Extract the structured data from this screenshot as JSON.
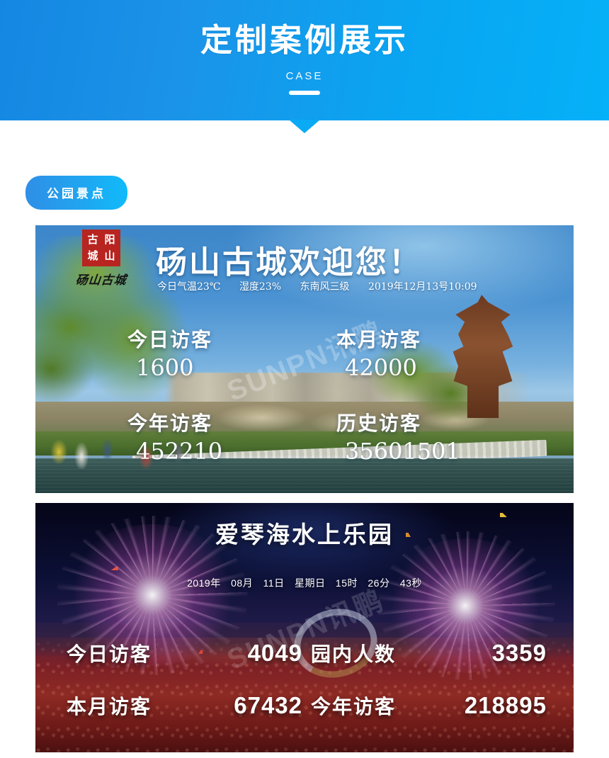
{
  "header": {
    "title": "定制案例展示",
    "subtitle": "CASE",
    "bg_gradient_from": "#1487e2",
    "bg_gradient_to": "#05b1f8"
  },
  "category_tag": {
    "label": "公园景点",
    "color_from": "#2f8fe6",
    "color_to": "#10bbfb"
  },
  "cards": [
    {
      "id": "dangshan-ancient-city",
      "logo_seal": [
        "古",
        "阳",
        "城",
        "山"
      ],
      "logo_wordmark": "砀山古城",
      "title": "砀山古城欢迎您！",
      "weather": [
        "今日气温23℃",
        "湿度23%",
        "东南风三级",
        "2019年12月13号10:09"
      ],
      "stats": [
        {
          "label": "今日访客",
          "value": "1600"
        },
        {
          "label": "本月访客",
          "value": "42000"
        },
        {
          "label": "今年访客",
          "value": "452210"
        },
        {
          "label": "历史访客",
          "value": "35601501"
        }
      ],
      "watermark": "SUNPN讯鹏"
    },
    {
      "id": "aegean-water-park",
      "title": "爱琴海水上乐园",
      "datetime": [
        "2019年",
        "08月",
        "11日",
        "星期日",
        "15时",
        "26分",
        "43秒"
      ],
      "stats": [
        {
          "label": "今日访客",
          "value": "4049"
        },
        {
          "label": "园内人数",
          "value": "3359"
        },
        {
          "label": "本月访客",
          "value": "67432"
        },
        {
          "label": "今年访客",
          "value": "218895"
        }
      ],
      "watermark": "SUNPN讯鹏"
    }
  ]
}
